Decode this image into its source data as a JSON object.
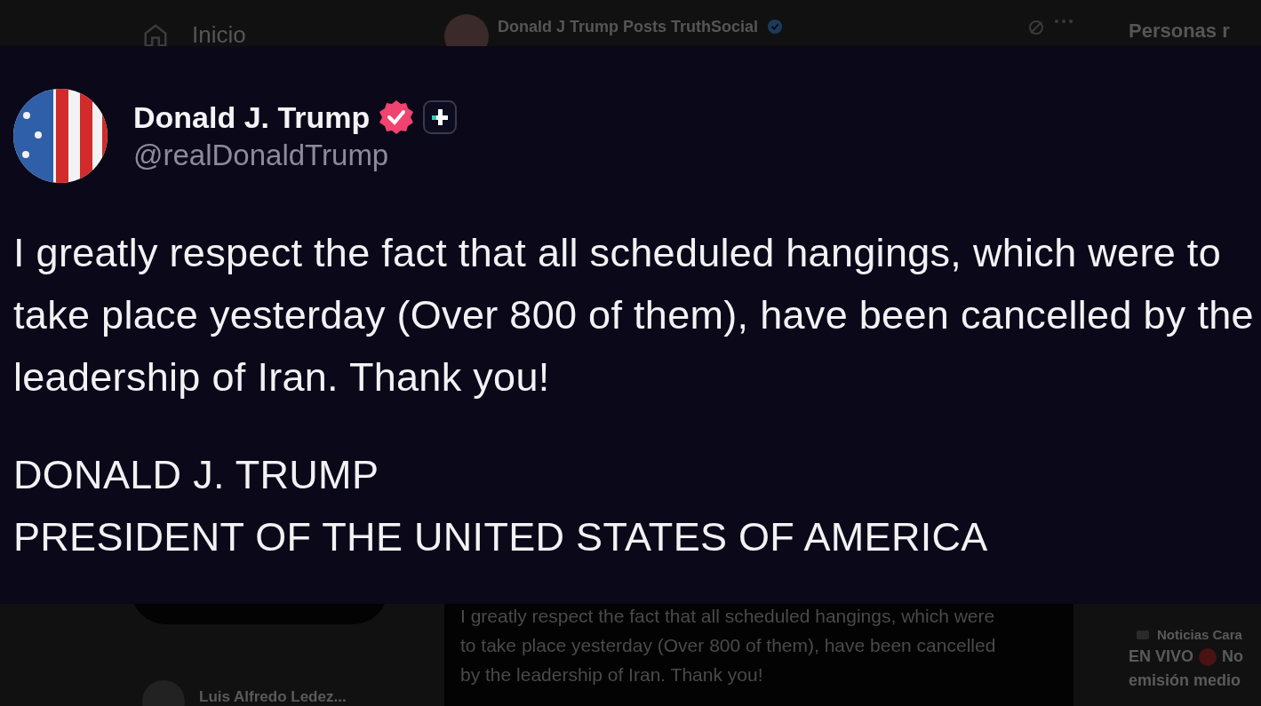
{
  "nav": {
    "home_label": "Inicio"
  },
  "timeline_header": {
    "account_name": "Donald J Trump Posts TruthSocial",
    "verified": true
  },
  "right_column": {
    "heading": "Personas r"
  },
  "overlay_post": {
    "name": "Donald J. Trump",
    "verified": true,
    "handle": "@realDonaldTrump",
    "body": "I greatly respect the fact that all scheduled hangings, which were to take place yesterday (Over 800 of them), have been cancelled by the leadership of Iran. Thank you!",
    "signature": [
      "DONALD J. TRUMP",
      "PRESIDENT OF THE UNITED STATES OF AMERICA"
    ]
  },
  "background_post": {
    "lines": [
      "I greatly respect the fact that all scheduled hangings, which were",
      "to take place yesterday (Over 800 of them), have been cancelled",
      "by the leadership of Iran. Thank you!"
    ]
  },
  "suggested_account": {
    "name": "Luis Alfredo Ledez..."
  },
  "news": {
    "source": "Noticias Cara",
    "live_label": "EN VIVO",
    "headline_start": "No",
    "headline_line2": "emisión medio"
  }
}
